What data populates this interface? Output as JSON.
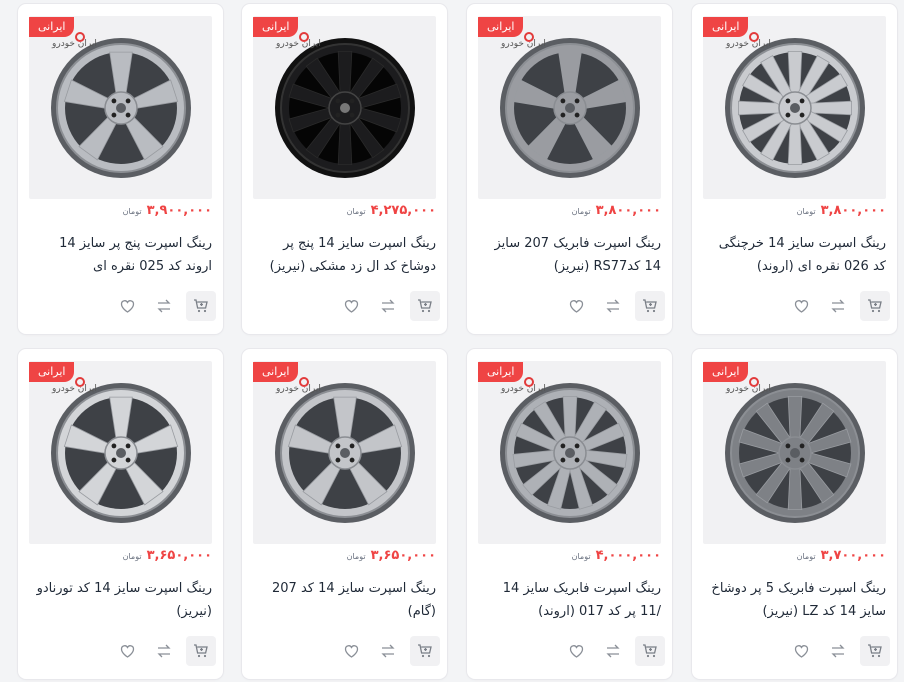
{
  "badge_label": "ایرانی",
  "brand_label": "ایران خودرو",
  "currency": "تومان",
  "products": [
    {
      "title": "رینگ اسپرت سایز 14 خرچنگی کد 026 نقره ای (اروند)",
      "price": "۳,۸۰۰,۰۰۰",
      "wheel_color": "#c9cbcf",
      "spokes": 12
    },
    {
      "title": "رینگ اسپرت فابریک 207 سایز 14 کدRS77 (نیریز)",
      "price": "۳,۸۰۰,۰۰۰",
      "wheel_color": "#9a9ca1",
      "spokes": 5
    },
    {
      "title": "رینگ اسپرت سایز 14 پنج پر دوشاخ کد ال زد مشکی (نیریز)",
      "price": "۴,۲۷۵,۰۰۰",
      "wheel_color": "#1c1c1e",
      "spokes": 10
    },
    {
      "title": "رینگ اسپرت پنج پر سایز 14 اروند کد 025 نقره ای",
      "price": "۳,۹۰۰,۰۰۰",
      "wheel_color": "#b9bcc1",
      "spokes": 5
    },
    {
      "title": "رینگ اسپرت فابریک 5 پر دوشاخ سایز 14 کد LZ (نیریز)",
      "price": "۳,۷۰۰,۰۰۰",
      "wheel_color": "#7e8186",
      "spokes": 10
    },
    {
      "title": "رینگ اسپرت فابریک سایز 14 /11 پر کد 017 (اروند)",
      "price": "۴,۰۰۰,۰۰۰",
      "wheel_color": "#aeb1b6",
      "spokes": 11
    },
    {
      "title": "رینگ اسپرت سایز 14 کد 207 (گام)",
      "price": "۳,۶۵۰,۰۰۰",
      "wheel_color": "#c3c5c9",
      "spokes": 5
    },
    {
      "title": "رینگ اسپرت سایز 14 کد تورنادو (نیریز)",
      "price": "۳,۶۵۰,۰۰۰",
      "wheel_color": "#d3d5d8",
      "spokes": 5
    }
  ]
}
